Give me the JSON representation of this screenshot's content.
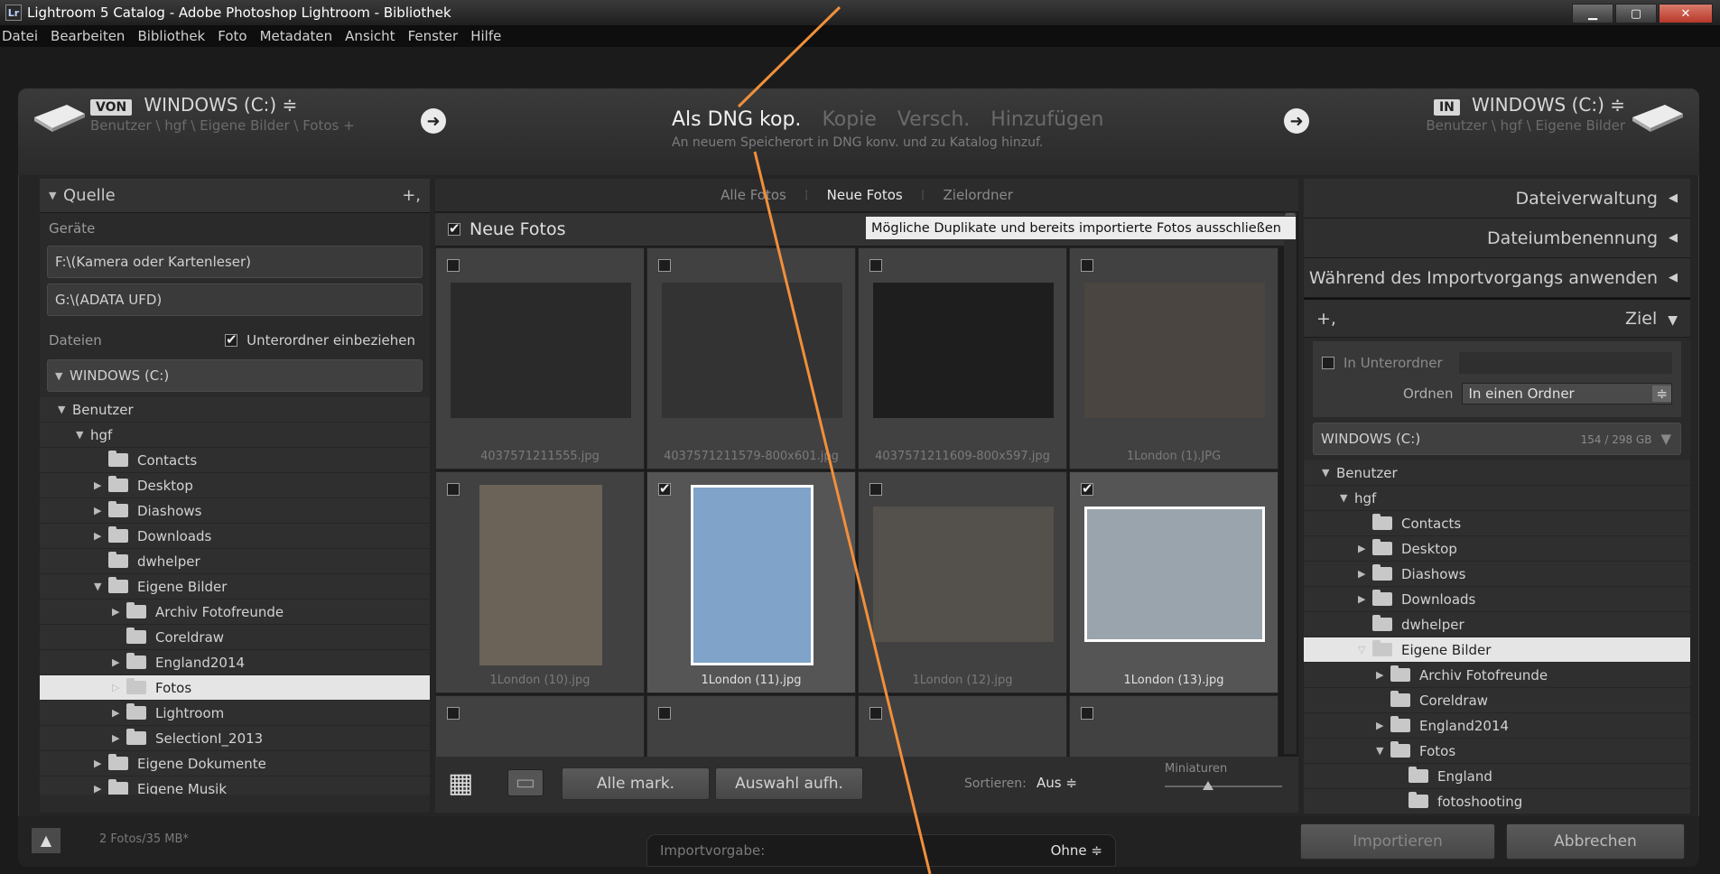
{
  "window": {
    "title": "Lightroom 5 Catalog - Adobe Photoshop Lightroom - Bibliothek",
    "badge": "Lr",
    "controls": {
      "minimize": "▁",
      "maximize": "▢",
      "close": "✕"
    }
  },
  "menu": [
    "Datei",
    "Bearbeiten",
    "Bibliothek",
    "Foto",
    "Metadaten",
    "Ansicht",
    "Fenster",
    "Hilfe"
  ],
  "header": {
    "from_tag": "VON",
    "from_drive": "WINDOWS (C:) ≑",
    "from_path": "Benutzer \\ hgf \\ Eigene Bilder \\ Fotos +",
    "modes": [
      "Als DNG kop.",
      "Kopie",
      "Versch.",
      "Hinzufügen"
    ],
    "mode_desc": "An neuem Speicherort in DNG konv. und zu Katalog hinzuf.",
    "to_tag": "IN",
    "to_drive": "WINDOWS (C:) ≑",
    "to_path": "Benutzer \\ hgf \\ Eigene Bilder",
    "arrow": "➜"
  },
  "left": {
    "title": "Quelle",
    "add": "+,",
    "devices_label": "Geräte",
    "devices": [
      "F:\\(Kamera oder Kartenleser)",
      "G:\\(ADATA UFD)"
    ],
    "files_label": "Dateien",
    "subfolders": "Unterordner einbeziehen",
    "drive": "WINDOWS (C:)",
    "tree": [
      {
        "label": "Benutzer",
        "level": 1,
        "tri": "▼",
        "folder": false
      },
      {
        "label": "hgf",
        "level": 2,
        "tri": "▼",
        "folder": false
      },
      {
        "label": "Contacts",
        "level": 3,
        "tri": "",
        "folder": true
      },
      {
        "label": "Desktop",
        "level": 3,
        "tri": "▶",
        "folder": true
      },
      {
        "label": "Diashows",
        "level": 3,
        "tri": "▶",
        "folder": true
      },
      {
        "label": "Downloads",
        "level": 3,
        "tri": "▶",
        "folder": true
      },
      {
        "label": "dwhelper",
        "level": 3,
        "tri": "",
        "folder": true
      },
      {
        "label": "Eigene Bilder",
        "level": 3,
        "tri": "▼",
        "folder": true
      },
      {
        "label": "Archiv Fotofreunde",
        "level": 4,
        "tri": "▶",
        "folder": true
      },
      {
        "label": "Coreldraw",
        "level": 4,
        "tri": "",
        "folder": true
      },
      {
        "label": "England2014",
        "level": 4,
        "tri": "▶",
        "folder": true
      },
      {
        "label": "Fotos",
        "level": 4,
        "tri": "▷",
        "folder": true,
        "selected": true
      },
      {
        "label": "Lightroom",
        "level": 4,
        "tri": "▶",
        "folder": true
      },
      {
        "label": "SelectionI_2013",
        "level": 4,
        "tri": "▶",
        "folder": true
      },
      {
        "label": "Eigene Dokumente",
        "level": 3,
        "tri": "▶",
        "folder": true
      },
      {
        "label": "Eigene Musik",
        "level": 3,
        "tri": "▶",
        "folder": true
      }
    ]
  },
  "center": {
    "tabs": [
      "Alle Fotos",
      "Neue Fotos",
      "Zielordner"
    ],
    "active_tab": "Neue Fotos",
    "section": "Neue Fotos",
    "tooltip": "Mögliche Duplikate und bereits importierte Fotos ausschließen",
    "photos": [
      {
        "name": "4037571211555.jpg",
        "checked": false,
        "tone": "#2a2a2a"
      },
      {
        "name": "4037571211579-800x601.jpg",
        "checked": false,
        "tone": "#333333"
      },
      {
        "name": "4037571211609-800x597.jpg",
        "checked": false,
        "tone": "#1e1e1e"
      },
      {
        "name": "1London (1).JPG",
        "checked": false,
        "tone": "#4a4540"
      },
      {
        "name": "1London (10).jpg",
        "checked": false,
        "tone": "#6b6258"
      },
      {
        "name": "1London (11).jpg",
        "checked": true,
        "tone": "#7fa3c9"
      },
      {
        "name": "1London (12).jpg",
        "checked": false,
        "tone": "#54504b"
      },
      {
        "name": "1London (13).jpg",
        "checked": true,
        "tone": "#9aa4ad"
      }
    ],
    "row3": [
      false,
      false,
      false,
      false
    ],
    "grid_icon": "▦",
    "loupe_icon": "▭",
    "mark_all": "Alle mark.",
    "unmark": "Auswahl aufh.",
    "sort_label": "Sortieren:",
    "sort_value": "Aus ≑",
    "thumbs_label": "Miniaturen"
  },
  "right": {
    "sections": [
      "Dateiverwaltung",
      "Dateiumbenennung",
      "Während des Importvorgangs anwenden"
    ],
    "collapse": "◀",
    "dest_title": "Ziel",
    "dest_tri": "▼",
    "add": "+,",
    "subfolder_label": "In Unterordner",
    "order_label": "Ordnen",
    "order_value": "In einen Ordner",
    "order_spin": "≑",
    "drive": "WINDOWS (C:)",
    "space": "154 / 298 GB",
    "tree": [
      {
        "label": "Benutzer",
        "level": 1,
        "tri": "▼",
        "folder": false
      },
      {
        "label": "hgf",
        "level": 2,
        "tri": "▼",
        "folder": false
      },
      {
        "label": "Contacts",
        "level": 3,
        "tri": "",
        "folder": true
      },
      {
        "label": "Desktop",
        "level": 3,
        "tri": "▶",
        "folder": true
      },
      {
        "label": "Diashows",
        "level": 3,
        "tri": "▶",
        "folder": true
      },
      {
        "label": "Downloads",
        "level": 3,
        "tri": "▶",
        "folder": true
      },
      {
        "label": "dwhelper",
        "level": 3,
        "tri": "",
        "folder": true
      },
      {
        "label": "Eigene Bilder",
        "level": 3,
        "tri": "▽",
        "folder": true,
        "selected": true
      },
      {
        "label": "Archiv Fotofreunde",
        "level": 4,
        "tri": "▶",
        "folder": true
      },
      {
        "label": "Coreldraw",
        "level": 4,
        "tri": "",
        "folder": true
      },
      {
        "label": "England2014",
        "level": 4,
        "tri": "▶",
        "folder": true
      },
      {
        "label": "Fotos",
        "level": 4,
        "tri": "▼",
        "folder": true
      },
      {
        "label": "England",
        "level": 5,
        "tri": "",
        "folder": true
      },
      {
        "label": "fotoshooting",
        "level": 5,
        "tri": "",
        "folder": true
      }
    ]
  },
  "footer": {
    "up": "▲",
    "count": "2 Fotos/35 MB*",
    "preset_label": "Importvorgabe:",
    "preset_value": "Ohne ≑",
    "import": "Importieren",
    "cancel": "Abbrechen"
  }
}
